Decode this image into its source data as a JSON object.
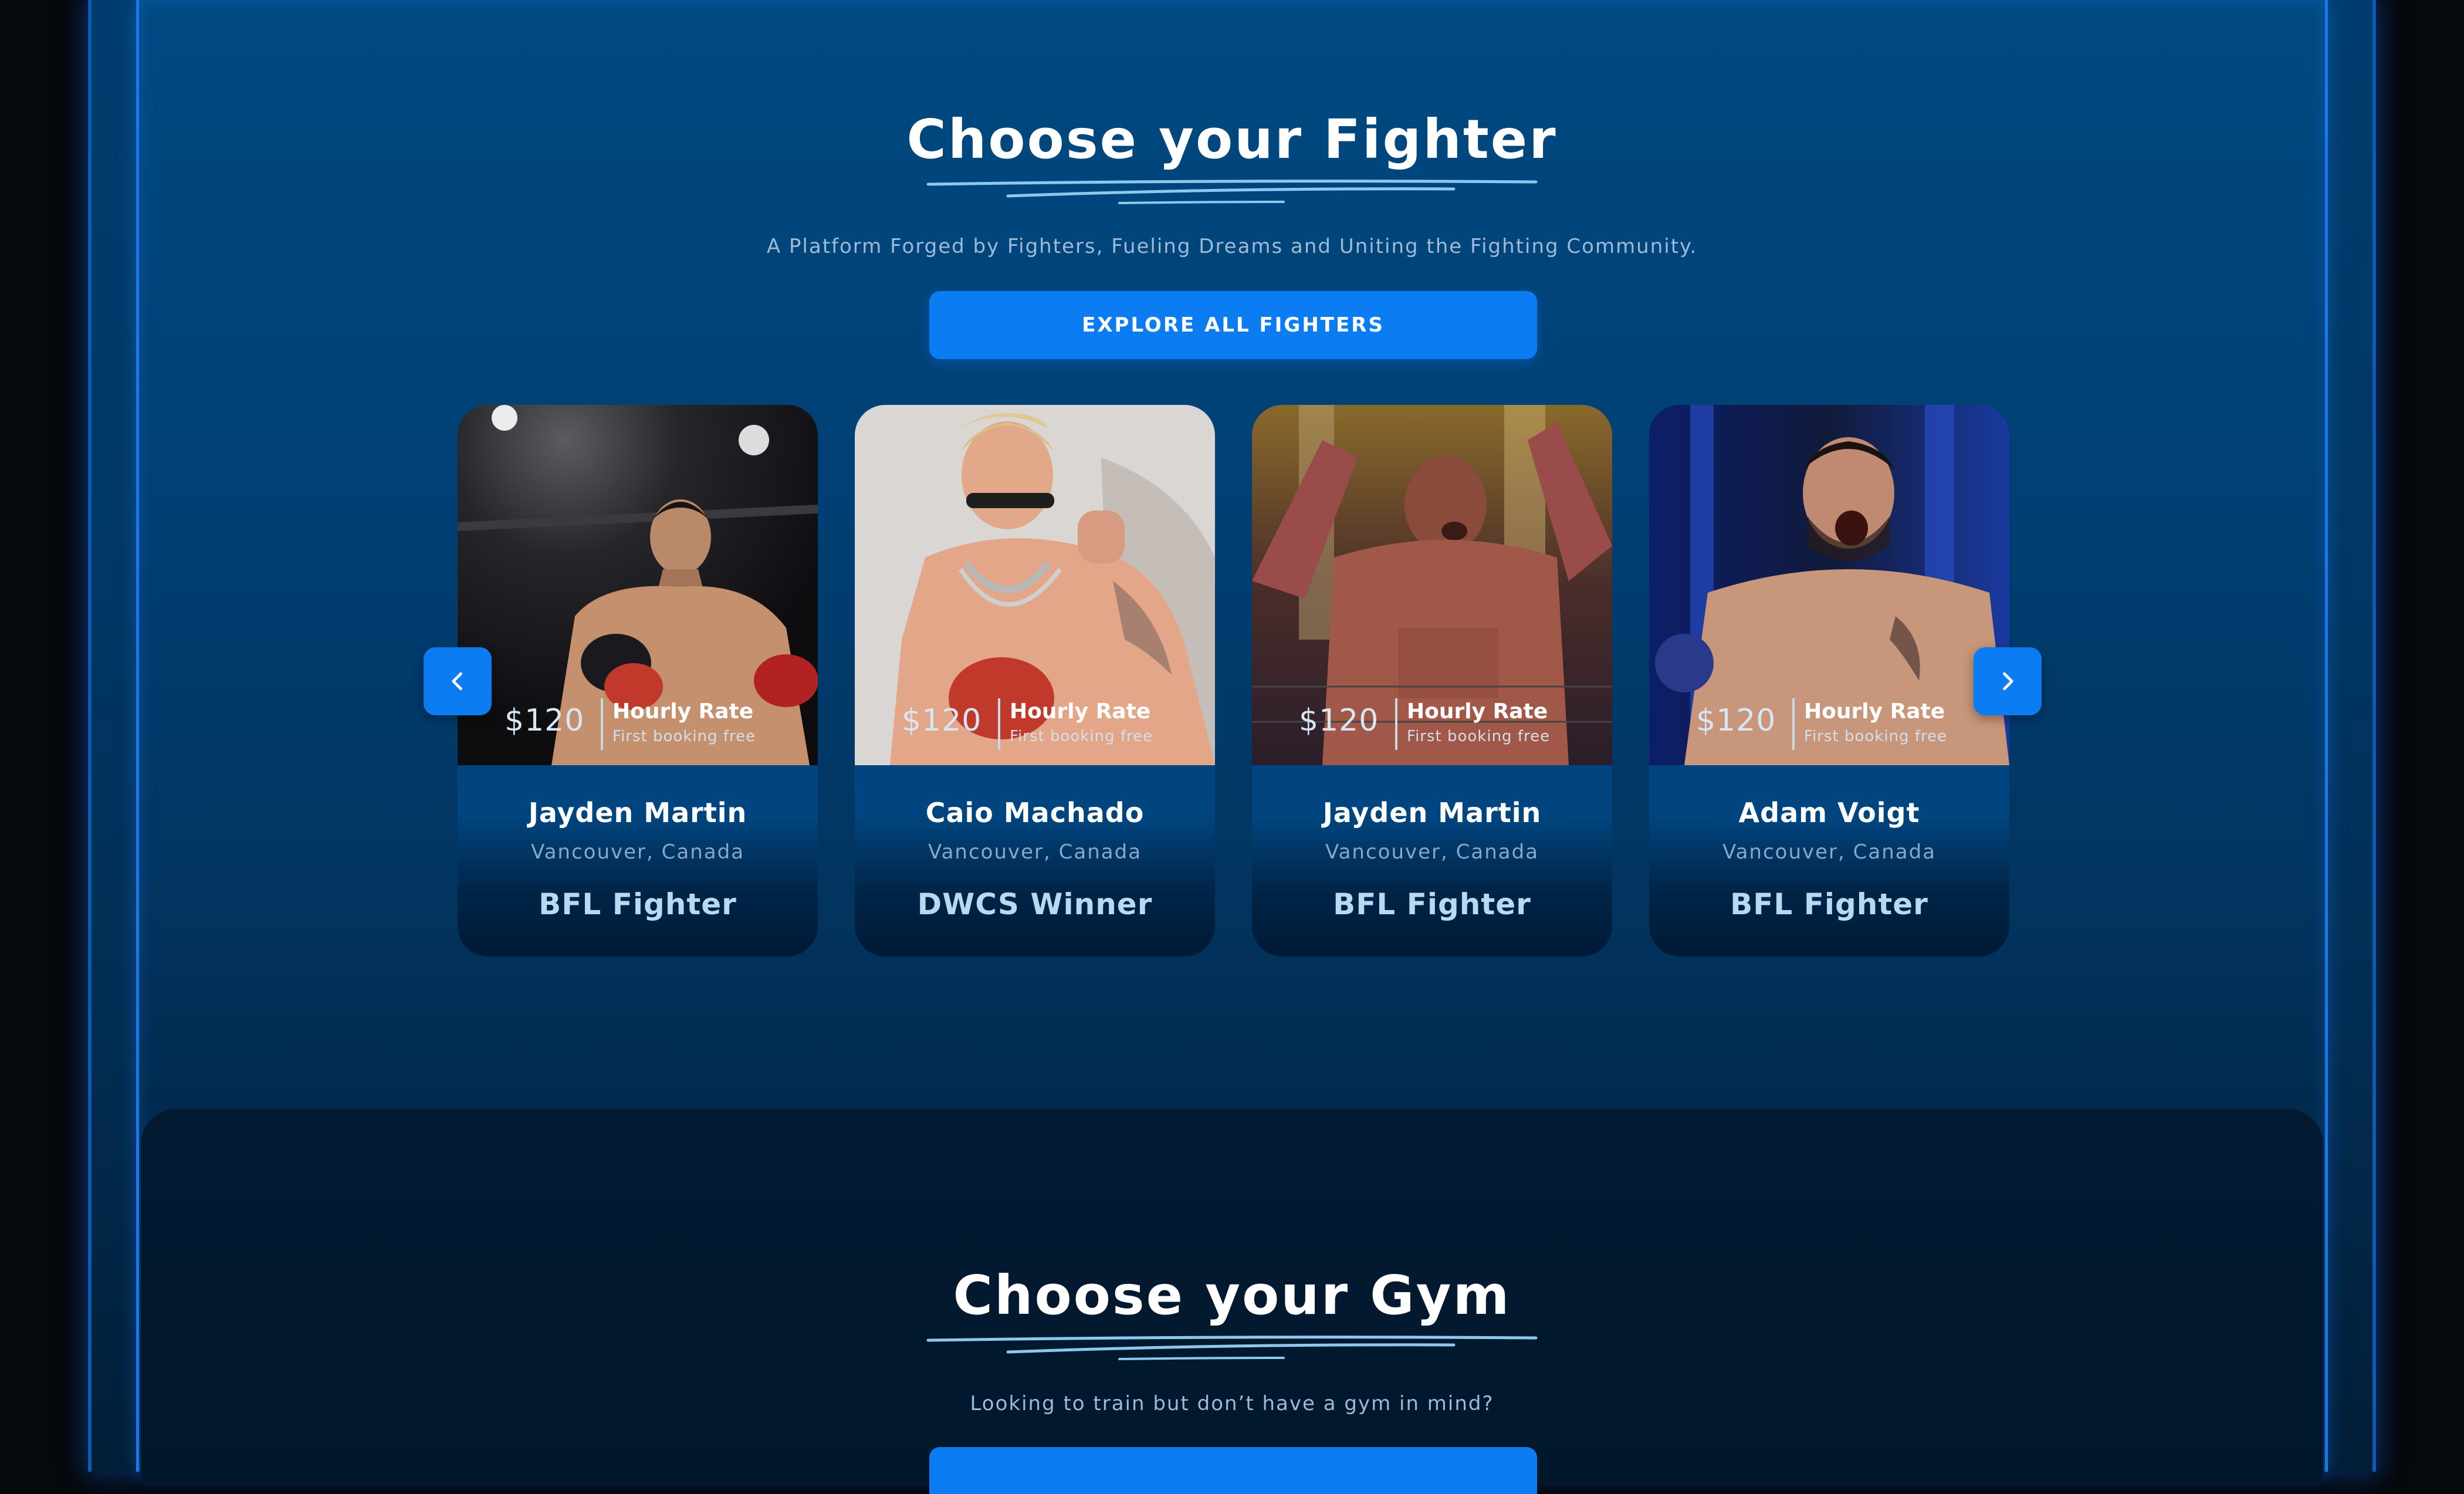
{
  "fighters_section": {
    "title": "Choose your Fighter",
    "subtitle": "A Platform Forged by Fighters, Fueling Dreams and Uniting the Fighting Community.",
    "cta_label": "EXPLORE ALL FIGHTERS",
    "prev_icon": "chevron-left-icon",
    "next_icon": "chevron-right-icon",
    "cards": [
      {
        "price": "$120",
        "rate_title": "Hourly Rate",
        "rate_sub": "First booking free",
        "name": "Jayden Martin",
        "location": "Vancouver, Canada",
        "tag": "BFL Fighter"
      },
      {
        "price": "$120",
        "rate_title": "Hourly Rate",
        "rate_sub": "First booking free",
        "name": "Caio Machado",
        "location": "Vancouver, Canada",
        "tag": "DWCS Winner"
      },
      {
        "price": "$120",
        "rate_title": "Hourly Rate",
        "rate_sub": "First booking free",
        "name": "Jayden Martin",
        "location": "Vancouver, Canada",
        "tag": "BFL Fighter"
      },
      {
        "price": "$120",
        "rate_title": "Hourly Rate",
        "rate_sub": "First booking free",
        "name": "Adam Voigt",
        "location": "Vancouver, Canada",
        "tag": "BFL Fighter"
      }
    ]
  },
  "gym_section": {
    "title": "Choose your Gym",
    "subtitle": "Looking to train but don’t have a gym in mind?"
  },
  "colors": {
    "accent": "#0b7cf2",
    "card_bg": "#00457f",
    "tag_text": "#b9d8f2"
  }
}
